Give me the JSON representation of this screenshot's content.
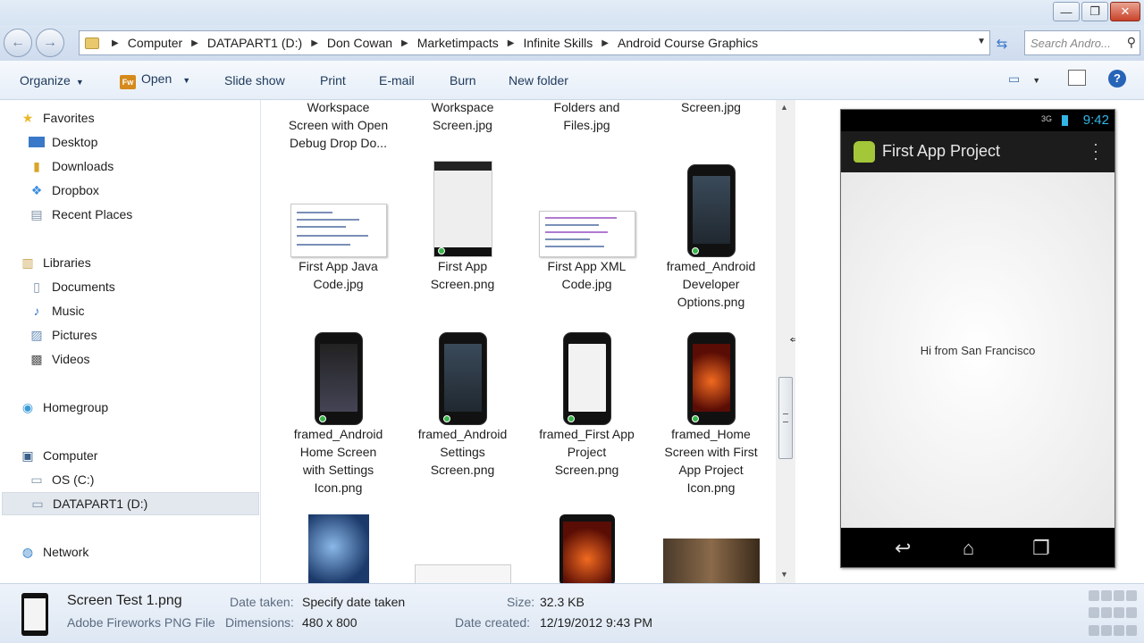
{
  "window": {
    "minimize": "—",
    "maximize": "❐",
    "close": "✕"
  },
  "address": {
    "crumbs": [
      "Computer",
      "DATAPART1 (D:)",
      "Don Cowan",
      "Marketimpacts",
      "Infinite Skills",
      "Android Course Graphics"
    ],
    "search_placeholder": "Search Andro..."
  },
  "toolbar": {
    "organize": "Organize",
    "open": "Open",
    "slideshow": "Slide show",
    "print": "Print",
    "email": "E-mail",
    "burn": "Burn",
    "new_folder": "New folder",
    "fw_badge": "Fw"
  },
  "nav": {
    "favorites": "Favorites",
    "desktop": "Desktop",
    "downloads": "Downloads",
    "dropbox": "Dropbox",
    "recent": "Recent Places",
    "libraries": "Libraries",
    "documents": "Documents",
    "music": "Music",
    "pictures": "Pictures",
    "videos": "Videos",
    "homegroup": "Homegroup",
    "computer": "Computer",
    "os_c": "OS (C:)",
    "datapart": "DATAPART1 (D:)",
    "network": "Network"
  },
  "files": {
    "row0": [
      [
        "Workspace",
        "Screen with Open",
        "Debug Drop Do..."
      ],
      [
        "Workspace",
        "Screen.jpg"
      ],
      [
        "Folders and",
        "Files.jpg"
      ],
      [
        "Screen.jpg"
      ]
    ],
    "row1": [
      [
        "First App Java",
        "Code.jpg"
      ],
      [
        "First App",
        "Screen.png"
      ],
      [
        "First App XML",
        "Code.jpg"
      ],
      [
        "framed_Android",
        "Developer",
        "Options.png"
      ]
    ],
    "row2": [
      [
        "framed_Android",
        "Home Screen",
        "with Settings",
        "Icon.png"
      ],
      [
        "framed_Android",
        "Settings",
        "Screen.png"
      ],
      [
        "framed_First App",
        "Project",
        "Screen.png"
      ],
      [
        "framed_Home",
        "Screen with First",
        "App Project",
        "Icon.png"
      ]
    ]
  },
  "preview": {
    "signal": "3G",
    "time": "9:42",
    "app_title": "First App Project",
    "message": "Hi from San Francisco"
  },
  "details": {
    "name": "Screen Test 1.png",
    "type": "Adobe Fireworks PNG File",
    "date_taken_label": "Date taken:",
    "date_taken_value": "Specify date taken",
    "dimensions_label": "Dimensions:",
    "dimensions_value": "480 x 800",
    "size_label": "Size:",
    "size_value": "32.3 KB",
    "created_label": "Date created:",
    "created_value": "12/19/2012 9:43 PM"
  },
  "colors": {
    "accent": "#2764b8",
    "android_green": "#a4c639",
    "holo_blue": "#33b5e5"
  }
}
